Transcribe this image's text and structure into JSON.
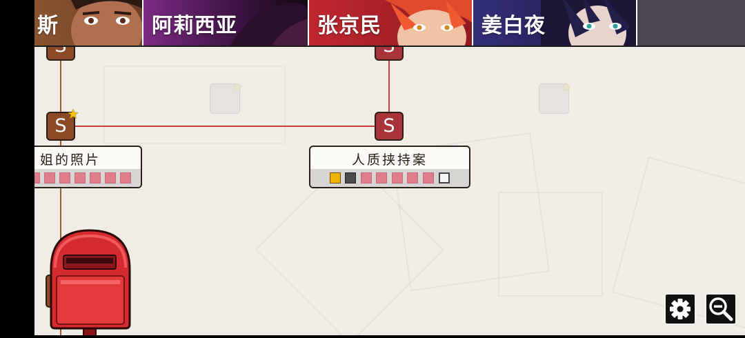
{
  "tabs": [
    {
      "label": "斯",
      "color": "#7a4a2a"
    },
    {
      "label": "阿莉西亚",
      "color": "#6a1f73"
    },
    {
      "label": "张京民",
      "color": "#b3272e"
    },
    {
      "label": "姜白夜",
      "color": "#2e2a66"
    }
  ],
  "cards": [
    {
      "title": "姐的照片",
      "squares": [
        "pink",
        "pink",
        "pink",
        "pink",
        "pink",
        "pink",
        "pink"
      ]
    },
    {
      "title": "人质挟持案",
      "squares": [
        "gold",
        "dark",
        "pink",
        "pink",
        "pink",
        "pink",
        "pink",
        "empty"
      ]
    }
  ],
  "nodes": {
    "symbol": "S"
  },
  "icons": {
    "settings": "gear-icon",
    "zoom_out": "zoom-out-icon",
    "mailbox": "mailbox-icon",
    "star": "star-icon"
  },
  "colors": {
    "line_red": "#cc3a3a",
    "line_brown": "#9a5a2d",
    "node_brown": "#8b4a25",
    "node_red": "#a83338",
    "background": "#efede6"
  }
}
